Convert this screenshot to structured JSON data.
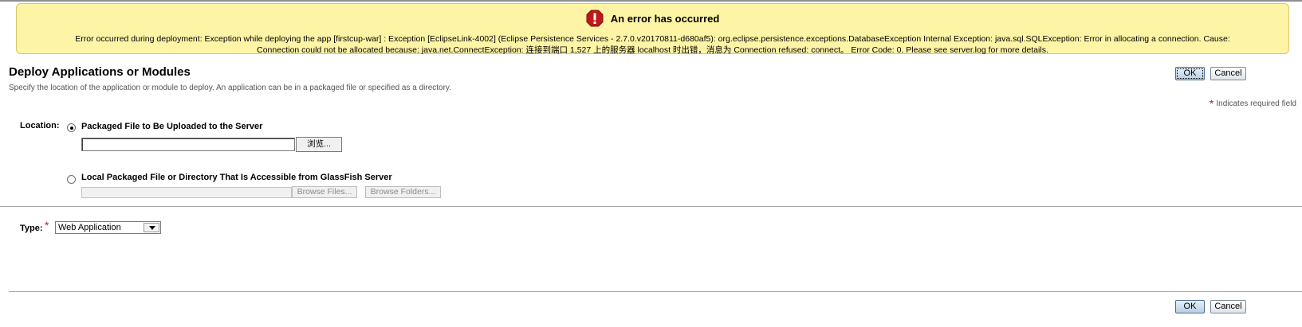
{
  "alert": {
    "title": "An error has occurred",
    "message_line1": "Error occurred during deployment: Exception while deploying the app [firstcup-war] : Exception [EclipseLink-4002] (Eclipse Persistence Services - 2.7.0.v20170811-d680af5): org.eclipse.persistence.exceptions.DatabaseException Internal Exception: java.sql.SQLException: Error in allocating a connection. Cause:",
    "message_line2": "Connection could not be allocated because: java.net.ConnectException: 连接到端口 1,527 上的服务器 localhost 时出错，消息为 Connection refused: connect。 Error Code: 0. Please see server.log for more details.",
    "icon": "error-icon",
    "color": "#fdf4a5"
  },
  "page": {
    "title": "Deploy Applications or Modules",
    "help": "Specify the location of the application or module to deploy. An application can be in a packaged file or specified as a directory.",
    "required_note": "Indicates required field"
  },
  "buttons": {
    "ok": "OK",
    "cancel": "Cancel"
  },
  "location": {
    "label": "Location:",
    "option_upload": "Packaged File to Be Uploaded to the Server",
    "browse_label": "浏览...",
    "upload_value": "",
    "option_local": "Local Packaged File or Directory That Is Accessible from GlassFish Server",
    "local_value": "",
    "browse_files": "Browse Files...",
    "browse_folders": "Browse Folders...",
    "selected": "upload"
  },
  "type": {
    "label": "Type:",
    "selected": "Web Application"
  },
  "colors": {
    "required_star": "#c21a1a",
    "banner_border": "#d9c56a"
  }
}
